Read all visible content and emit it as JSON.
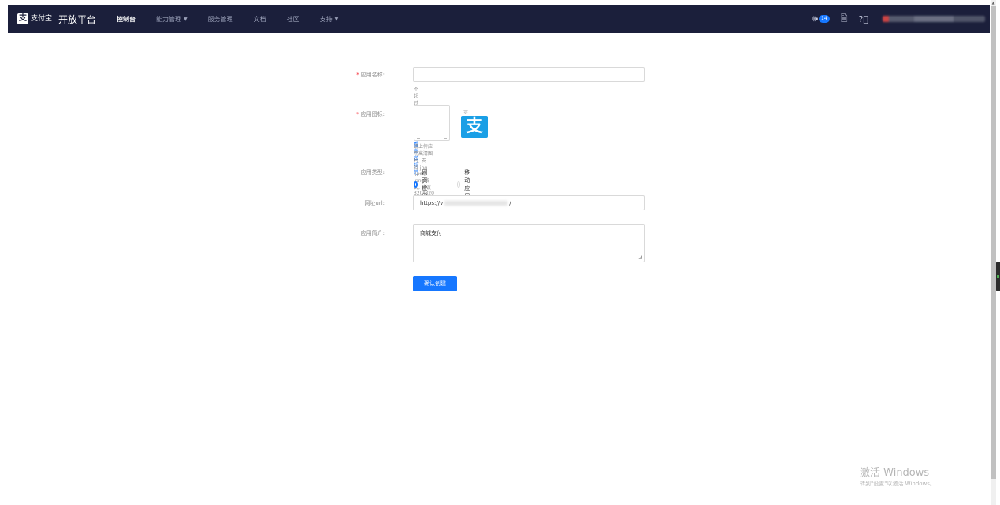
{
  "header": {
    "logo_glyph": "支",
    "logo_text": "支付宝",
    "platform": "开放平台",
    "nav": [
      {
        "label": "控制台",
        "active": true,
        "has_caret": false
      },
      {
        "label": "能力管理",
        "active": false,
        "has_caret": true
      },
      {
        "label": "服务管理",
        "active": false,
        "has_caret": false
      },
      {
        "label": "文档",
        "active": false,
        "has_caret": false
      },
      {
        "label": "社区",
        "active": false,
        "has_caret": false
      },
      {
        "label": "支持",
        "active": false,
        "has_caret": true
      }
    ],
    "notification_count": "14",
    "icons": {
      "speaker": "speaker-icon",
      "doc": "document-check-icon",
      "help": "question-circle-icon"
    }
  },
  "form": {
    "app_name": {
      "required_mark": "*",
      "label": "应用名称:",
      "value": "",
      "hint": "不超过32个字符,",
      "hint_link": "查看命名规范"
    },
    "app_icon": {
      "required_mark": "*",
      "label": "应用图标:",
      "sample_label": "示意图",
      "sample_glyph": "支",
      "hint": "请上传应用高清图片, 支持.jpg .jpeg .png格式, 建议320*320像素, 小于3M"
    },
    "app_type": {
      "label": "应用类型:",
      "options": [
        {
          "label": "网页应用",
          "checked": true
        },
        {
          "label": "移动应用",
          "checked": false
        }
      ]
    },
    "site_url": {
      "label": "网址url:",
      "value_prefix": "https://v",
      "value_suffix": "/"
    },
    "app_intro": {
      "label": "应用简介:",
      "value": "商城支付"
    },
    "submit_label": "确认创建"
  },
  "watermark": {
    "line1": "激活 Windows",
    "line2": "转到\"设置\"以激活 Windows。"
  },
  "colors": {
    "topbar": "#1b1f3b",
    "primary": "#1677ff",
    "required": "#f5222d"
  }
}
